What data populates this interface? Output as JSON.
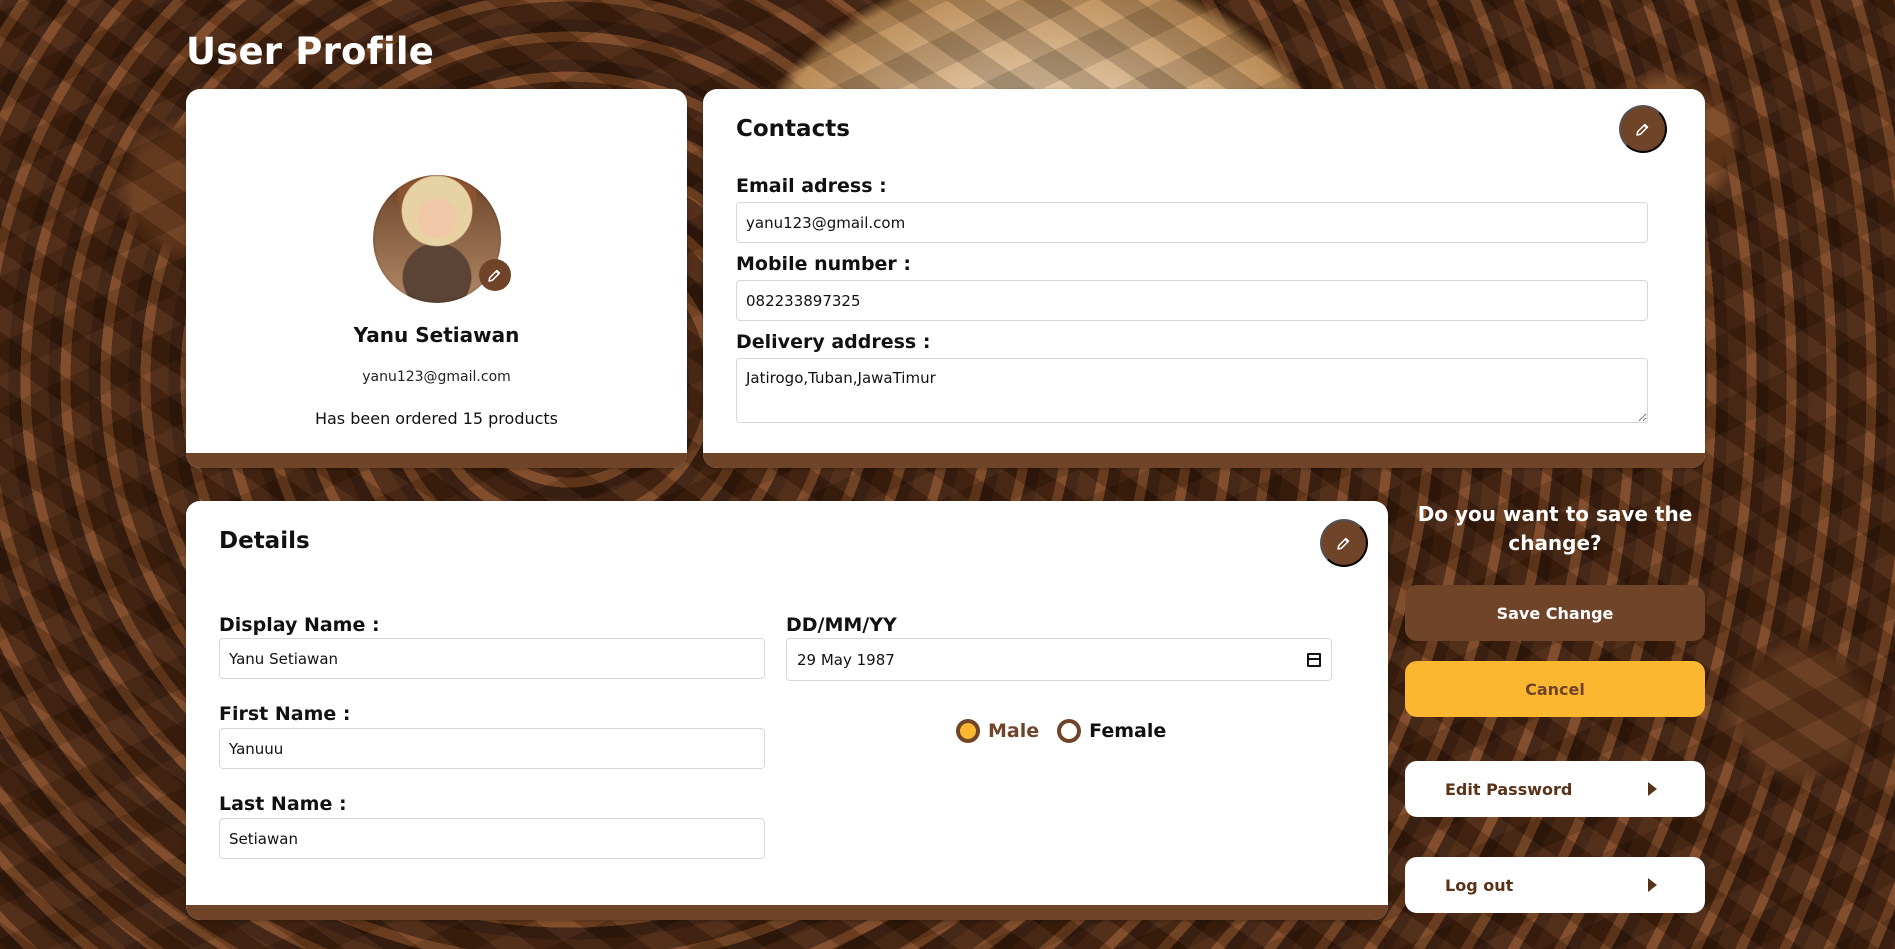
{
  "page": {
    "title": "User Profile"
  },
  "profile": {
    "name": "Yanu Setiawan",
    "email": "yanu123@gmail.com",
    "orders_text": "Has been ordered 15 products",
    "avatar_icon": "user-photo",
    "edit_icon": "pencil-icon"
  },
  "contacts": {
    "title": "Contacts",
    "edit_icon": "pencil-icon",
    "email_label": "Email adress :",
    "email_value": "yanu123@gmail.com",
    "mobile_label": "Mobile number :",
    "mobile_value": "082233897325",
    "address_label": "Delivery address :",
    "address_value": "Jatirogo,Tuban,JawaTimur"
  },
  "details": {
    "title": "Details",
    "edit_icon": "pencil-icon",
    "display_name_label": "Display Name :",
    "display_name_value": "Yanu Setiawan",
    "first_name_label": "First Name :",
    "first_name_value": "Yanuuu",
    "last_name_label": "Last Name :",
    "last_name_value": "Setiawan",
    "date_label": "DD/MM/YY",
    "date_value": "29 May 1987",
    "gender_options": [
      {
        "label": "Male",
        "selected": true
      },
      {
        "label": "Female",
        "selected": false
      }
    ]
  },
  "actions": {
    "question": "Do you want to save the change?",
    "save_label": "Save Change",
    "cancel_label": "Cancel",
    "edit_password_label": "Edit Password",
    "logout_label": "Log out"
  },
  "colors": {
    "brand_brown": "#6f4429",
    "accent_yellow": "#fbb730",
    "text_dark": "#111111",
    "white": "#ffffff"
  }
}
